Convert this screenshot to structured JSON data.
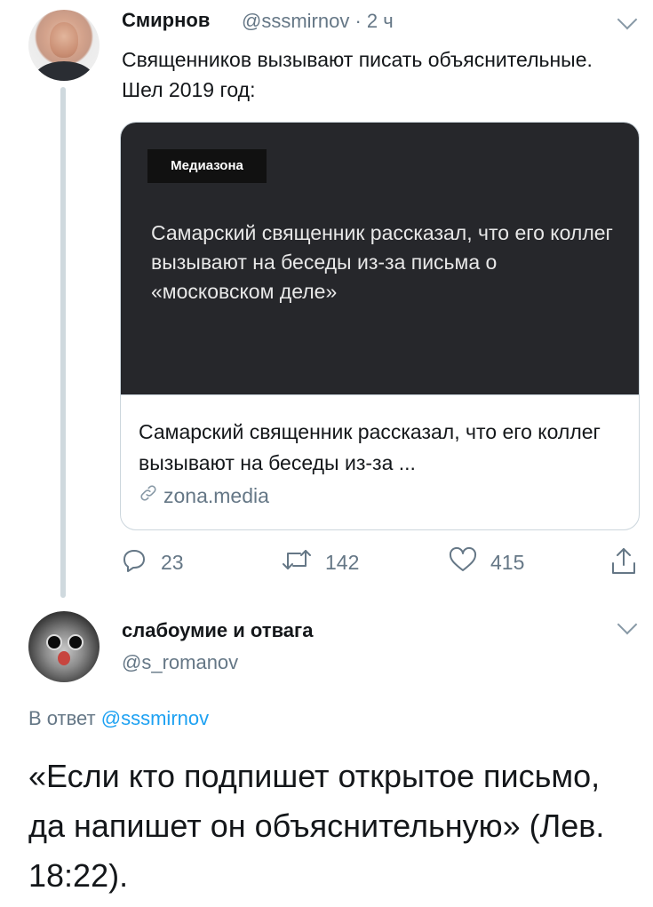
{
  "tweet1": {
    "author_name": "Смирнов",
    "author_handle": "@sssmirnov",
    "time": "2 ч",
    "text": "Священников вызывают писать объяснительные. Шел 2019 год:",
    "card": {
      "badge": "Медиазона",
      "image_text": "Самарский священник рассказал, что его коллег вызывают на беседы из-за письма о «московском деле»",
      "title": "Самарский священник рассказал, что его коллег вызывают на беседы из-за ...",
      "link": "zona.media"
    },
    "actions": {
      "replies": "23",
      "retweets": "142",
      "likes": "415"
    }
  },
  "tweet2": {
    "author_name": "слабоумие и отвага",
    "author_handle": "@s_romanov",
    "reply_prefix": "В ответ",
    "reply_mention": "@sssmirnov",
    "text": "«Если кто подпишет открытое письмо, да напишет он объяснительную» (Лев. 18:22)."
  },
  "icons": {
    "reply": "reply-icon",
    "retweet": "retweet-icon",
    "like": "heart-icon",
    "share": "share-icon",
    "link": "link-icon",
    "more": "chevron-down-icon"
  },
  "colors": {
    "text": "#14171a",
    "secondary": "#657786",
    "link": "#1da1f2",
    "border": "#ccd6dd",
    "card_bg": "#26272b"
  }
}
